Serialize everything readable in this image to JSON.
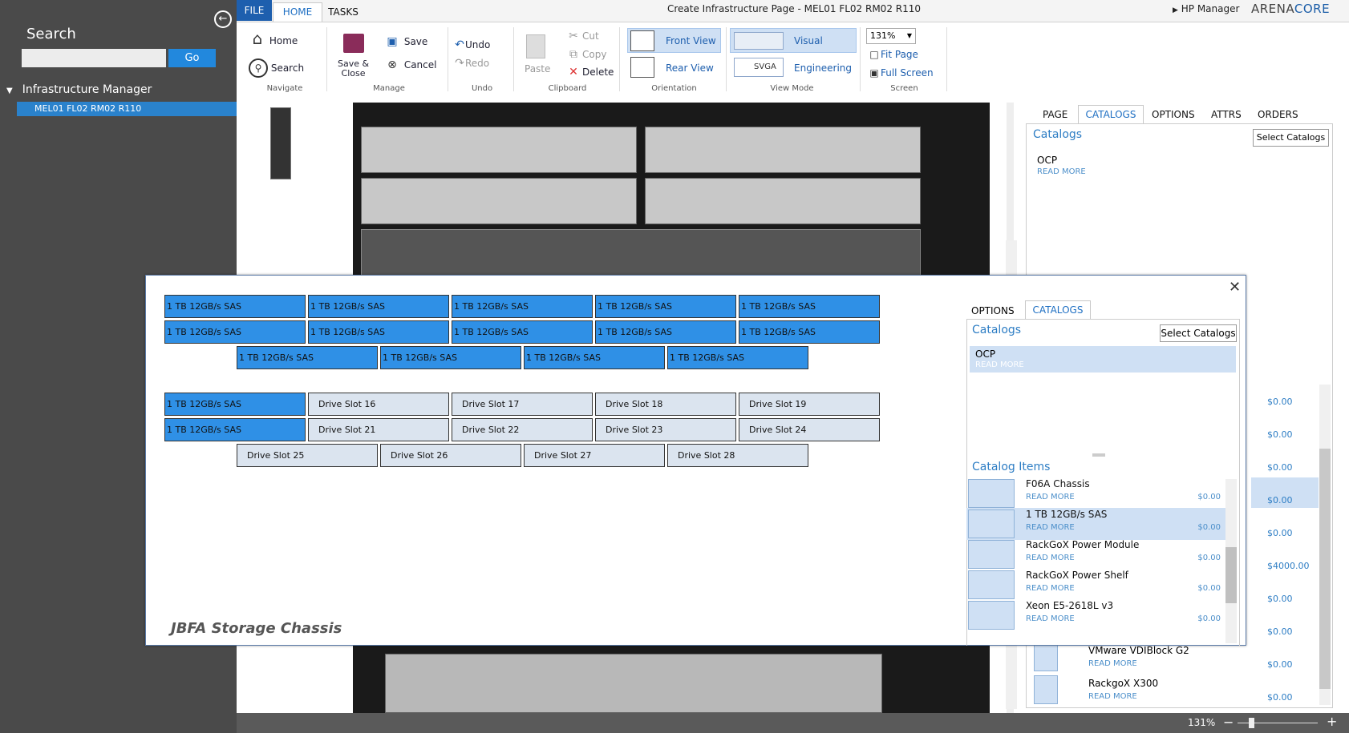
{
  "sidebar": {
    "title": "Search",
    "search_placeholder": "",
    "go_label": "Go",
    "tree_root": "Infrastructure Manager",
    "tree_child": "MEL01 FL02 RM02 R110"
  },
  "ribbon": {
    "tabs": [
      "FILE",
      "HOME",
      "TASKS"
    ],
    "window_title": "Create Infrastructure Page - MEL01 FL02 RM02 R110",
    "user": "HP Manager",
    "logo_a": "ARENA",
    "logo_b": "CORE",
    "navigate": {
      "home": "Home",
      "search": "Search",
      "label": "Navigate"
    },
    "manage": {
      "save_close_1": "Save &",
      "save_close_2": "Close",
      "save": "Save",
      "cancel": "Cancel",
      "label": "Manage"
    },
    "undo": {
      "undo": "Undo",
      "redo": "Redo",
      "label": "Undo"
    },
    "clipboard": {
      "paste": "Paste",
      "cut": "Cut",
      "copy": "Copy",
      "delete": "Delete",
      "label": "Clipboard"
    },
    "orientation": {
      "front": "Front View",
      "rear": "Rear View",
      "label": "Orientation"
    },
    "viewmode": {
      "visual": "Visual",
      "engineering": "Engineering",
      "svga": "SVGA",
      "label": "View Mode"
    },
    "screen": {
      "zoom": "131%",
      "fit": "Fit Page",
      "full": "Full Screen",
      "label": "Screen"
    }
  },
  "right_panel": {
    "tabs": [
      "PAGE",
      "CATALOGS",
      "OPTIONS",
      "ATTRS",
      "ORDERS"
    ],
    "catalogs_title": "Catalogs",
    "select_catalogs": "Select Catalogs",
    "catalog_name": "OCP",
    "read_more": "READ MORE",
    "prices": [
      "$0.00",
      "$0.00",
      "$0.00",
      "$0.00",
      "$0.00",
      "$4000.00",
      "$0.00",
      "$0.00",
      "$0.00",
      "$0.00"
    ],
    "bottom_items": [
      {
        "name": "VMware VDIBlock G2",
        "read_more": "READ MORE",
        "price": "$0.00"
      },
      {
        "name": "RackgoX X300",
        "read_more": "READ MORE",
        "price": "$0.00"
      }
    ]
  },
  "status": {
    "zoom": "131%"
  },
  "modal": {
    "title": "JBFA Storage Chassis",
    "close_icon": "close-icon",
    "rows": [
      [
        "1 TB 12GB/s SAS",
        "1 TB 12GB/s SAS",
        "1 TB 12GB/s SAS",
        "1 TB 12GB/s SAS",
        "1 TB 12GB/s SAS"
      ],
      [
        "1 TB 12GB/s SAS",
        "1 TB 12GB/s SAS",
        "1 TB 12GB/s SAS",
        "1 TB 12GB/s SAS",
        "1 TB 12GB/s SAS"
      ],
      [
        "1 TB 12GB/s SAS",
        "1 TB 12GB/s SAS",
        "1 TB 12GB/s SAS",
        "1 TB 12GB/s SAS"
      ],
      [
        "1 TB 12GB/s SAS",
        "Drive Slot 16",
        "Drive Slot 17",
        "Drive Slot 18",
        "Drive Slot 19"
      ],
      [
        "1 TB 12GB/s SAS",
        "Drive Slot 21",
        "Drive Slot 22",
        "Drive Slot 23",
        "Drive Slot 24"
      ],
      [
        "Drive Slot 25",
        "Drive Slot 26",
        "Drive Slot 27",
        "Drive Slot 28"
      ]
    ],
    "panel": {
      "tabs": [
        "OPTIONS",
        "CATALOGS"
      ],
      "catalogs_title": "Catalogs",
      "select_catalogs": "Select Catalogs",
      "catalog_name": "OCP",
      "read_more": "READ MORE",
      "items_title": "Catalog Items",
      "items": [
        {
          "name": "F06A Chassis",
          "read_more": "READ MORE",
          "price": "$0.00"
        },
        {
          "name": "1 TB 12GB/s SAS",
          "read_more": "READ MORE",
          "price": "$0.00"
        },
        {
          "name": "RackGoX Power Module",
          "read_more": "READ MORE",
          "price": "$0.00"
        },
        {
          "name": "RackGoX Power Shelf",
          "read_more": "READ MORE",
          "price": "$0.00"
        },
        {
          "name": "Xeon E5-2618L v3",
          "read_more": "READ MORE",
          "price": "$0.00"
        }
      ]
    }
  }
}
